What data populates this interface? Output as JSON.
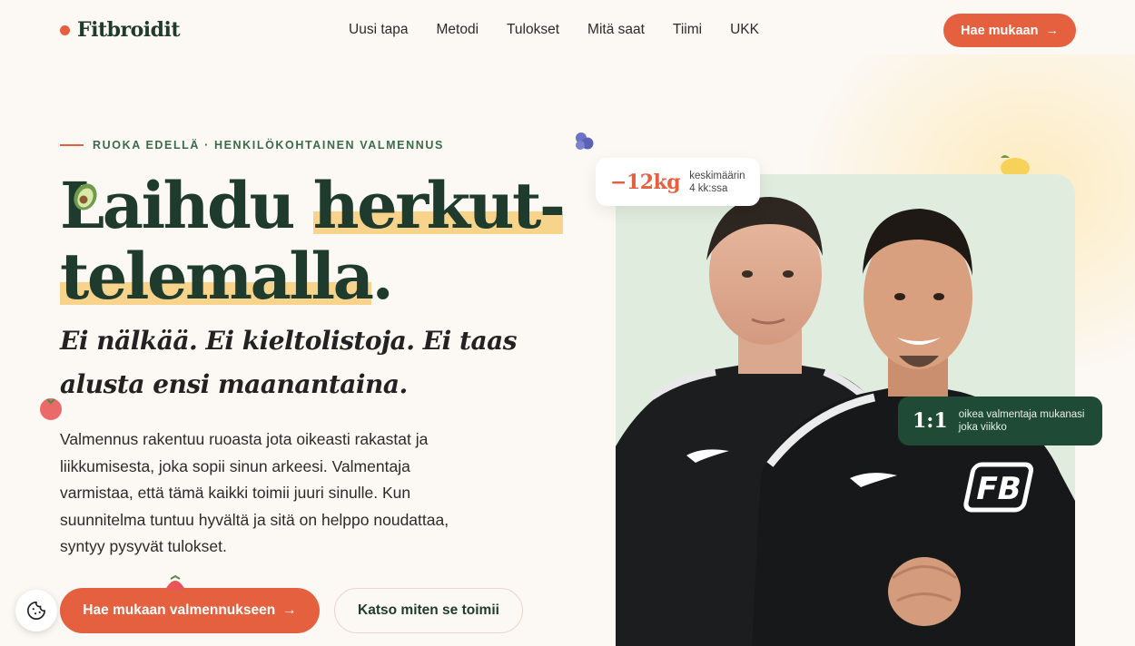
{
  "brand": {
    "name": "Fitbroidit"
  },
  "nav": {
    "items": [
      "Uusi tapa",
      "Metodi",
      "Tulokset",
      "Mitä saat",
      "Tiimi",
      "UKK"
    ],
    "cta_label": "Hae mukaan",
    "cta_arrow": "→"
  },
  "hero": {
    "eyebrow": "RUOKA EDELLÄ · HENKILÖKOHTAINEN VALMENNUS",
    "headline_part1": "Laihdu ",
    "headline_highlight1": "herkut-",
    "headline_highlight2": "telemalla",
    "headline_end": ".",
    "subhead": "Ei nälkää. Ei kieltolistoja. Ei taas alusta ensi maanantaina.",
    "body": "Valmennus rakentuu ruoasta jota oikeasti rakastat ja liikkumisesta, joka sopii sinun arkeesi. Valmentaja varmistaa, että tämä kaikki toimii juuri sinulle. Kun suunnitelma tuntuu hyvältä ja sitä on helppo noudattaa, syntyy pysyvät tulokset.",
    "primary_cta": "Hae mukaan valmennukseen",
    "primary_arrow": "→",
    "secondary_cta": "Katso miten se toimii"
  },
  "badges": {
    "stat_value": "−12kg",
    "stat_line1": "keskimäärin",
    "stat_line2": "4 kk:ssa",
    "ratio_value": "1:1",
    "ratio_line1": "oikea valmentaja mukanasi",
    "ratio_line2": "joka viikko"
  },
  "colors": {
    "accent": "#e4603f",
    "primary_green": "#1f3b2e",
    "badge_green": "#1f4a35",
    "highlight": "#f7d38c",
    "background": "#fcf8f3"
  }
}
